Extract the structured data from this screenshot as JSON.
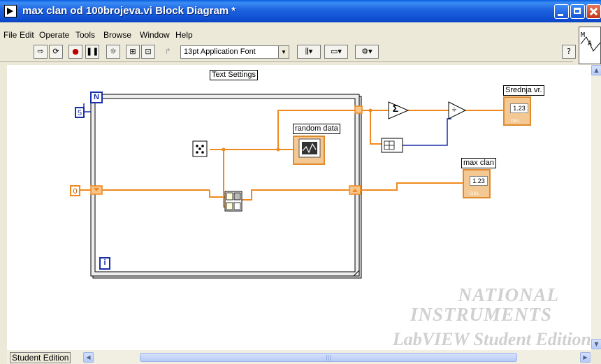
{
  "window": {
    "title": "max clan od 100brojeva.vi Block Diagram *"
  },
  "menu": [
    "File",
    "Edit",
    "Operate",
    "Tools",
    "Browse",
    "Window",
    "Help"
  ],
  "toolbar": {
    "font": "13pt Application Font"
  },
  "diagram": {
    "text_settings_label": "Text Settings",
    "n_terminal": "N",
    "n_constant": "5",
    "init_constant": "0",
    "iteration_terminal": "i",
    "random_data_label": "random data",
    "srednja_label": "Srednja vr.",
    "max_label": "max clan",
    "indicator_value": "1.23",
    "indicator_type": "DBL",
    "sum_symbol": "Σ",
    "divide_symbol": "÷"
  },
  "status": {
    "label": "Student Edition"
  },
  "watermark": {
    "line1": "NATIONAL",
    "line2": "INSTRUMENTS",
    "line3": "LabVIEW Student Edition"
  },
  "colors": {
    "orange_wire": "#f08a1e",
    "blue_wire": "#1a2ea8",
    "title_bar": "#0a5fde"
  }
}
